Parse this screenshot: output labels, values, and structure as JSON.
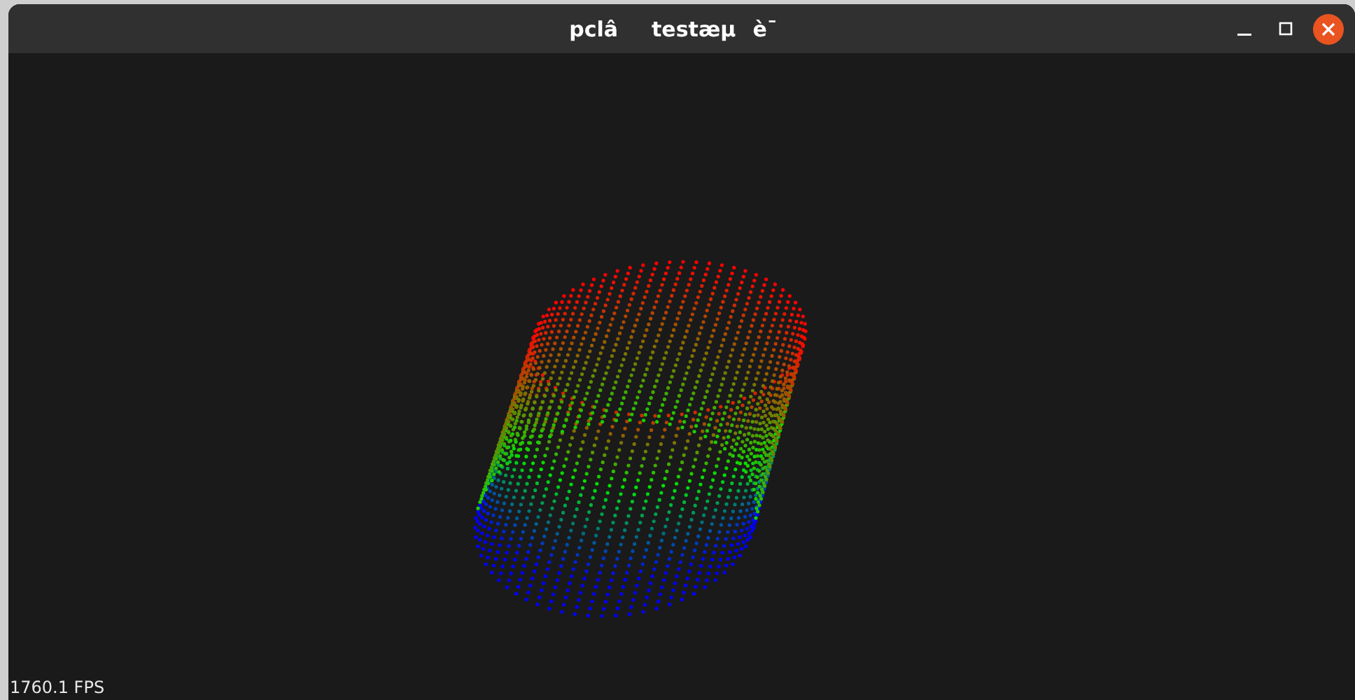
{
  "window": {
    "title": "pclâtestæµè¯"
  },
  "viewer": {
    "fps": "1760.1 FPS"
  }
}
